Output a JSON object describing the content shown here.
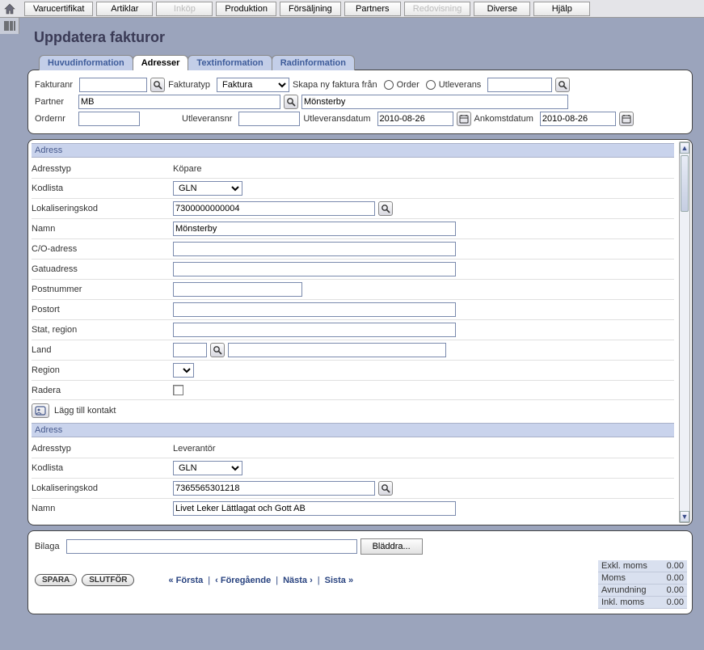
{
  "menu": {
    "items": [
      {
        "label": "Varucertifikat",
        "disabled": false
      },
      {
        "label": "Artiklar",
        "disabled": false
      },
      {
        "label": "Inköp",
        "disabled": true
      },
      {
        "label": "Produktion",
        "disabled": false
      },
      {
        "label": "Försäljning",
        "disabled": false
      },
      {
        "label": "Partners",
        "disabled": false
      },
      {
        "label": "Redovisning",
        "disabled": true
      },
      {
        "label": "Diverse",
        "disabled": false
      },
      {
        "label": "Hjälp",
        "disabled": false
      }
    ]
  },
  "page": {
    "title": "Uppdatera fakturor"
  },
  "tabs": [
    {
      "label": "Huvudinformation",
      "active": false
    },
    {
      "label": "Adresser",
      "active": true
    },
    {
      "label": "Textinformation",
      "active": false
    },
    {
      "label": "Radinformation",
      "active": false
    }
  ],
  "header": {
    "fakturanr_label": "Fakturanr",
    "fakturanr": "",
    "fakturatyp_label": "Fakturatyp",
    "fakturatyp": "Faktura",
    "skapa_label": "Skapa ny faktura från",
    "order_label": "Order",
    "utleverans_label": "Utleverans",
    "utlev_ref": "",
    "partner_label": "Partner",
    "partner_code": "MB",
    "partner_name": "Mönsterby",
    "ordernr_label": "Ordernr",
    "ordernr": "",
    "utleveransnr_label": "Utleveransnr",
    "utleveransnr": "",
    "utleveransdatum_label": "Utleveransdatum",
    "utleveransdatum": "2010-08-26",
    "ankomstdatum_label": "Ankomstdatum",
    "ankomstdatum": "2010-08-26"
  },
  "address1": {
    "section": "Adress",
    "adresstyp_label": "Adresstyp",
    "adresstyp": "Köpare",
    "kodlista_label": "Kodlista",
    "kodlista": "GLN",
    "lokkod_label": "Lokaliseringskod",
    "lokkod": "7300000000004",
    "namn_label": "Namn",
    "namn": "Mönsterby",
    "co_label": "C/O-adress",
    "co": "",
    "gatu_label": "Gatuadress",
    "gatu": "",
    "postnr_label": "Postnummer",
    "postnr": "",
    "postort_label": "Postort",
    "postort": "",
    "stat_label": "Stat, region",
    "stat": "",
    "land_label": "Land",
    "land_code": "",
    "land_name": "",
    "region_label": "Region",
    "radera_label": "Radera",
    "add_contact": "Lägg till kontakt"
  },
  "address2": {
    "section": "Adress",
    "adresstyp_label": "Adresstyp",
    "adresstyp": "Leverantör",
    "kodlista_label": "Kodlista",
    "kodlista": "GLN",
    "lokkod_label": "Lokaliseringskod",
    "lokkod": "7365565301218",
    "namn_label": "Namn",
    "namn": "Livet Leker Lättlagat och Gott AB"
  },
  "footer": {
    "bilaga_label": "Bilaga",
    "bilaga": "",
    "bladdra": "Bläddra...",
    "spara": "SPARA",
    "slutfor": "SLUTFÖR",
    "nav_first": "« Första",
    "nav_prev": "‹ Föregående",
    "nav_next": "Nästa ›",
    "nav_last": "Sista »",
    "nav_sep": "|",
    "totals": {
      "exkl_label": "Exkl. moms",
      "exkl": "0.00",
      "moms_label": "Moms",
      "moms": "0.00",
      "avr_label": "Avrundning",
      "avr": "0.00",
      "inkl_label": "Inkl. moms",
      "inkl": "0.00"
    }
  }
}
